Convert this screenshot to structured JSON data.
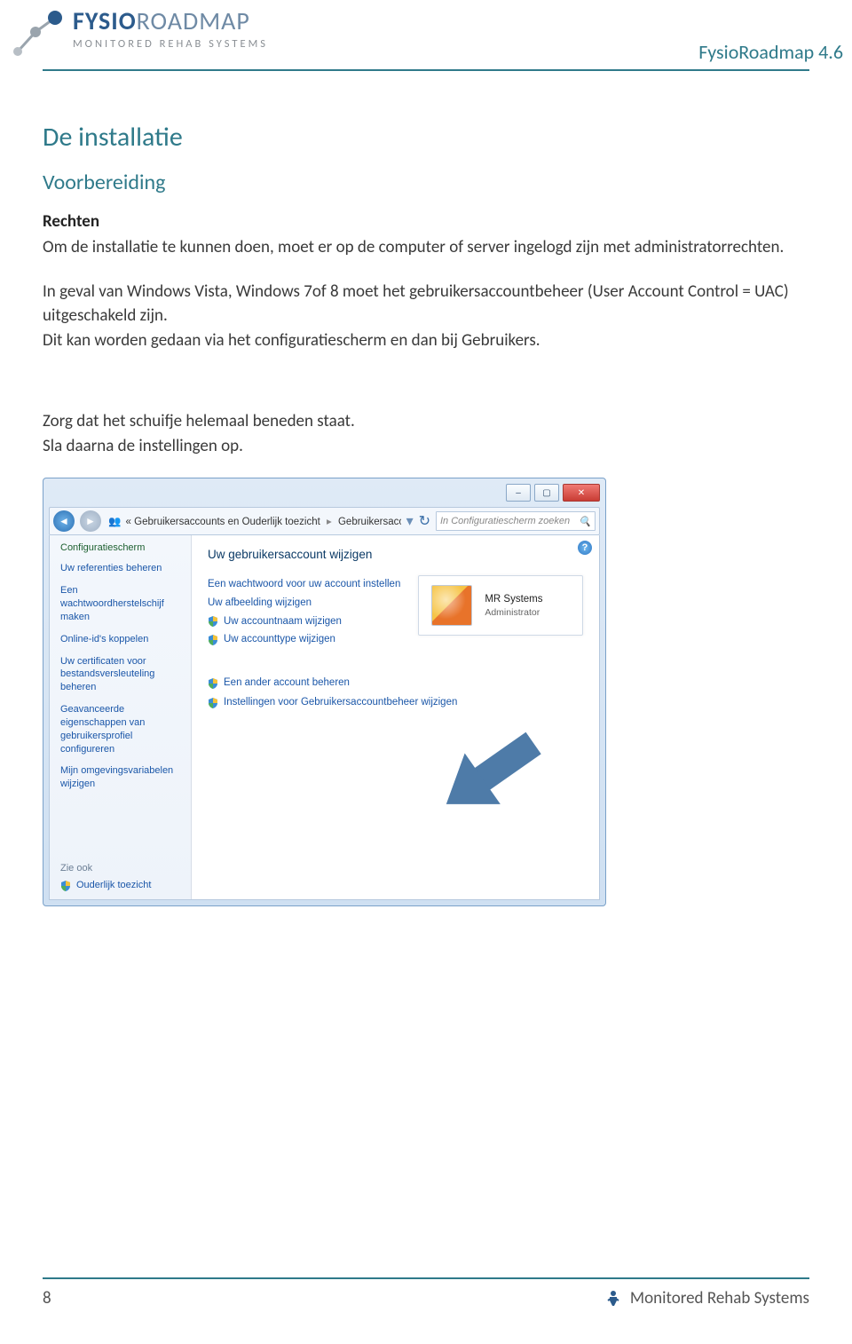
{
  "header": {
    "logo_bold": "FYSIO",
    "logo_thin": "ROADMAP",
    "logo_sub": "MONITORED REHAB SYSTEMS",
    "version": "FysioRoadmap 4.6"
  },
  "headings": {
    "h1": "De installatie",
    "h2": "Voorbereiding",
    "h3": "Rechten"
  },
  "paragraphs": {
    "p1": "Om de installatie te kunnen doen, moet er op de computer of server ingelogd zijn met administratorrechten.",
    "p2": "In geval van Windows Vista, Windows 7of 8 moet het gebruikersaccountbeheer (User Account Control = UAC) uitgeschakeld zijn.",
    "p3": "Dit kan worden gedaan via het configuratiescherm en dan bij Gebruikers.",
    "p4": "Zorg dat het schuifje helemaal beneden staat.",
    "p5": "Sla daarna de instellingen op."
  },
  "win": {
    "breadcrumb_prefix": "«",
    "breadcrumb1": "Gebruikersaccounts en Ouderlijk toezicht",
    "breadcrumb2": "Gebruikersaccounts",
    "search_placeholder": "In Configuratiescherm zoeken",
    "sidebar": {
      "title": "Configuratiescherm",
      "links": [
        "Uw referenties beheren",
        "Een wachtwoordherstelschijf maken",
        "Online-id's koppelen",
        "Uw certificaten voor bestandsversleuteling beheren",
        "Geavanceerde eigenschappen van gebruikersprofiel configureren",
        "Mijn omgevingsvariabelen wijzigen"
      ],
      "zie": "Zie ook",
      "footer": "Ouderlijk toezicht"
    },
    "main": {
      "title": "Uw gebruikersaccount wijzigen",
      "links1": [
        "Een wachtwoord voor uw account instellen",
        "Uw afbeelding wijzigen",
        "Uw accountnaam wijzigen",
        "Uw accounttype wijzigen"
      ],
      "links2": [
        "Een ander account beheren",
        "Instellingen voor Gebruikersaccountbeheer wijzigen"
      ],
      "user_name": "MR Systems",
      "user_role": "Administrator"
    }
  },
  "footer": {
    "page": "8",
    "brand": "Monitored Rehab Systems"
  }
}
